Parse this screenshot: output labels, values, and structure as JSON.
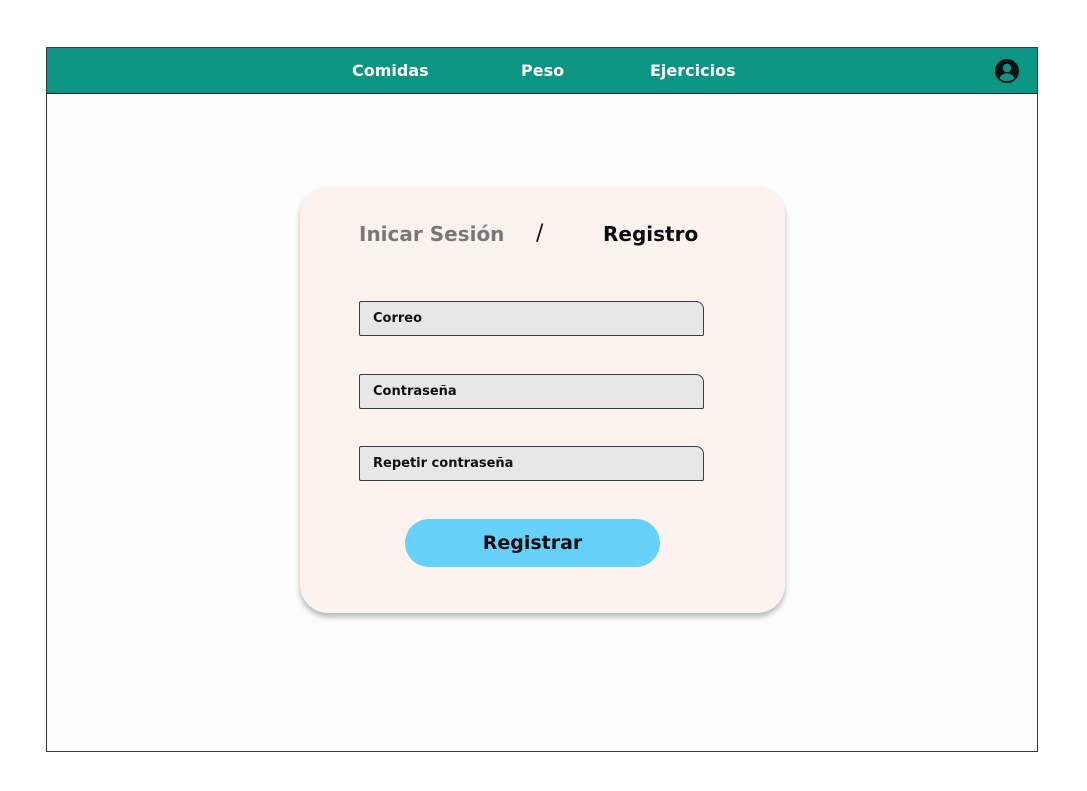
{
  "nav": {
    "items": [
      {
        "label": "Comidas"
      },
      {
        "label": "Peso"
      },
      {
        "label": "Ejercicios"
      }
    ],
    "profile_icon": "user-circle-icon"
  },
  "auth": {
    "tabs": {
      "login": "Inicar Sesión",
      "separator": "/",
      "register": "Registro"
    },
    "fields": {
      "email_placeholder": "Correo",
      "password_placeholder": "Contraseña",
      "repeat_placeholder": "Repetir contraseña"
    },
    "submit_label": "Registrar"
  },
  "colors": {
    "navbar": "#0a9683",
    "card": "#fcf3ee",
    "button": "#66d1f9",
    "field": "#e7e7e7",
    "inactive_tab": "#7a7876"
  }
}
